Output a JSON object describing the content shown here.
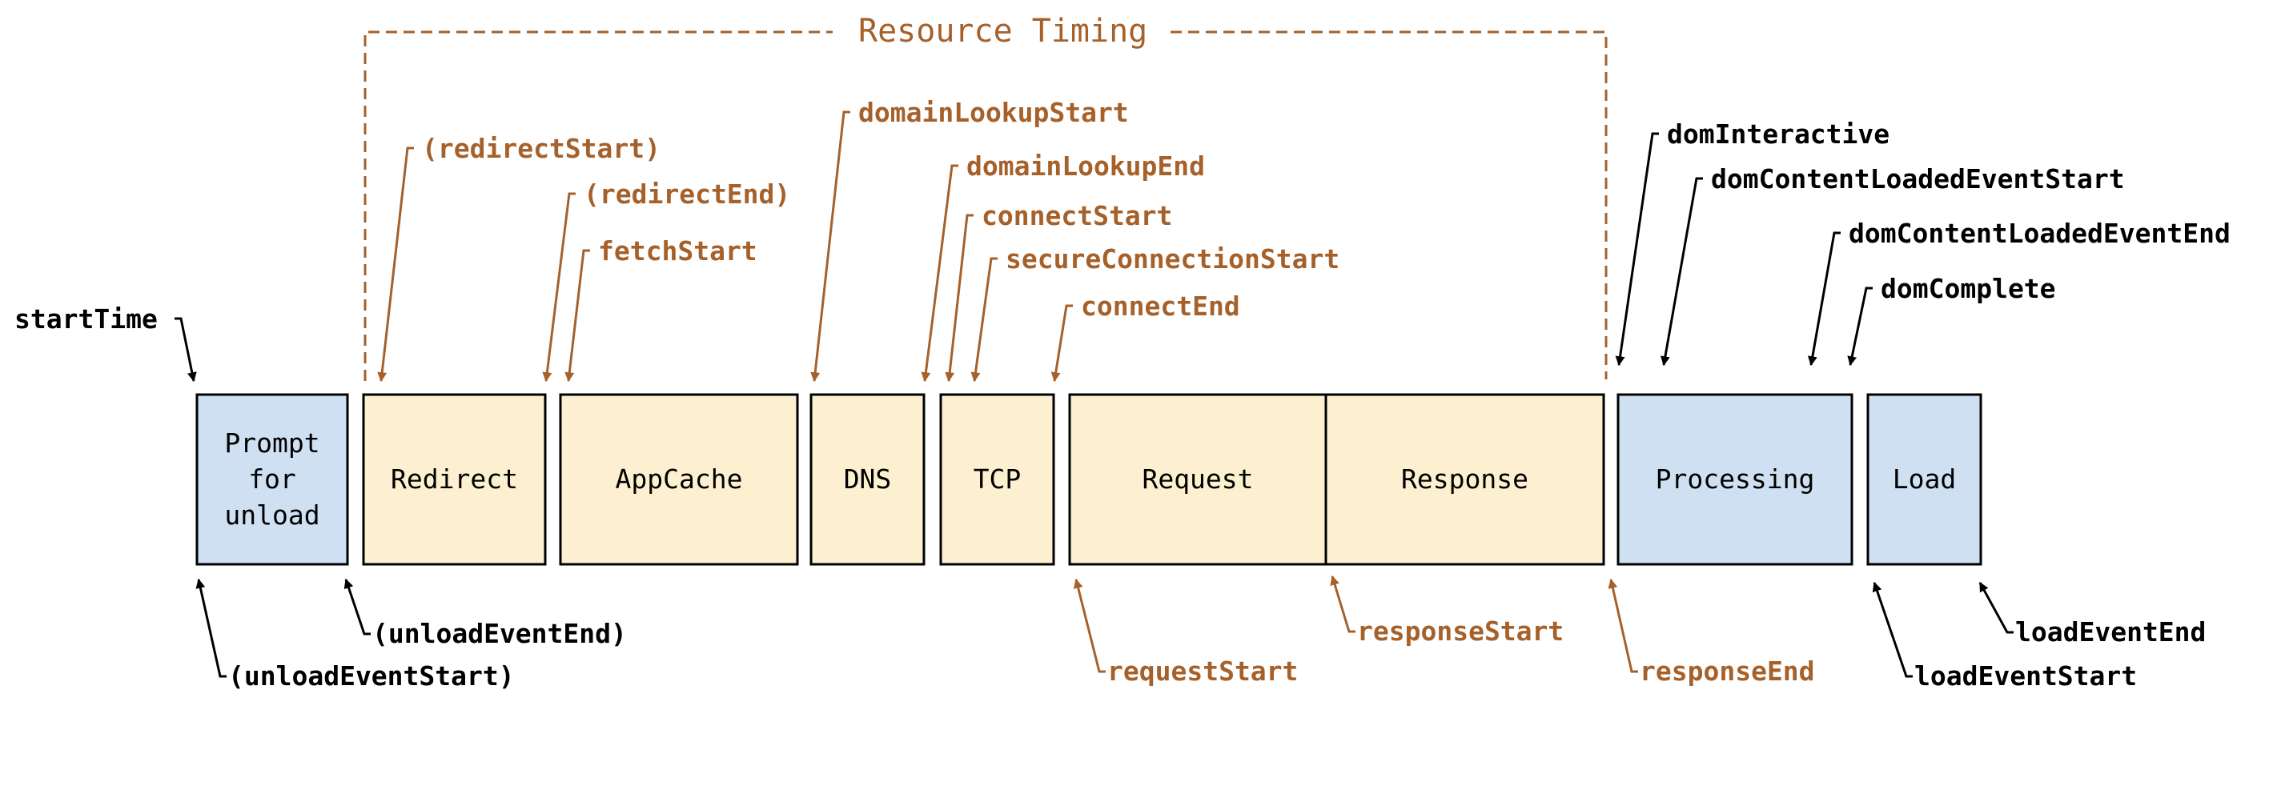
{
  "title": "Resource Timing",
  "colors": {
    "resource": "#A6612B",
    "navigation": "#000000",
    "box_blue": "#CFE0F3",
    "box_yellow": "#FDF0D0",
    "border": "#000000"
  },
  "phases": [
    {
      "id": "prompt",
      "lines": [
        "Prompt",
        "for",
        "unload"
      ],
      "group": "navigation"
    },
    {
      "id": "redirect",
      "lines": [
        "Redirect"
      ],
      "group": "resource"
    },
    {
      "id": "appcache",
      "lines": [
        "AppCache"
      ],
      "group": "resource"
    },
    {
      "id": "dns",
      "lines": [
        "DNS"
      ],
      "group": "resource"
    },
    {
      "id": "tcp",
      "lines": [
        "TCP"
      ],
      "group": "resource"
    },
    {
      "id": "request",
      "lines": [
        "Request"
      ],
      "group": "resource"
    },
    {
      "id": "response",
      "lines": [
        "Response"
      ],
      "group": "resource"
    },
    {
      "id": "processing",
      "lines": [
        "Processing"
      ],
      "group": "navigation"
    },
    {
      "id": "load",
      "lines": [
        "Load"
      ],
      "group": "navigation"
    }
  ],
  "markers_top": [
    {
      "label": "startTime",
      "group": "navigation"
    },
    {
      "label": "(redirectStart)",
      "group": "resource"
    },
    {
      "label": "(redirectEnd)",
      "group": "resource"
    },
    {
      "label": "fetchStart",
      "group": "resource"
    },
    {
      "label": "domainLookupStart",
      "group": "resource"
    },
    {
      "label": "domainLookupEnd",
      "group": "resource"
    },
    {
      "label": "connectStart",
      "group": "resource"
    },
    {
      "label": "secureConnectionStart",
      "group": "resource"
    },
    {
      "label": "connectEnd",
      "group": "resource"
    },
    {
      "label": "domInteractive",
      "group": "navigation"
    },
    {
      "label": "domContentLoadedEventStart",
      "group": "navigation"
    },
    {
      "label": "domContentLoadedEventEnd",
      "group": "navigation"
    },
    {
      "label": "domComplete",
      "group": "navigation"
    }
  ],
  "markers_bottom": [
    {
      "label": "(unloadEventStart)",
      "group": "navigation"
    },
    {
      "label": "(unloadEventEnd)",
      "group": "navigation"
    },
    {
      "label": "requestStart",
      "group": "resource"
    },
    {
      "label": "responseStart",
      "group": "resource"
    },
    {
      "label": "responseEnd",
      "group": "resource"
    },
    {
      "label": "loadEventStart",
      "group": "navigation"
    },
    {
      "label": "loadEventEnd",
      "group": "navigation"
    }
  ]
}
